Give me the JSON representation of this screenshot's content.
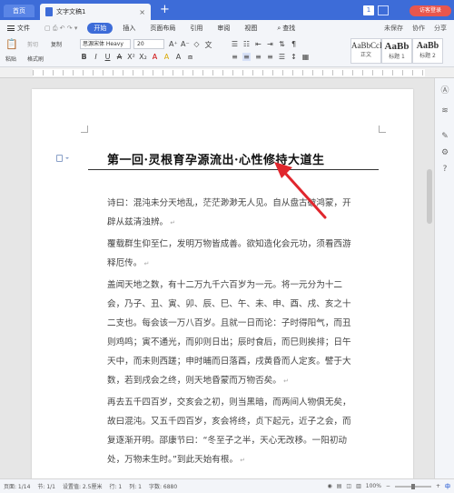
{
  "titlebar": {
    "home_tab": "首页",
    "doc_tab": "文字文稿1",
    "close_glyph": "×",
    "add_glyph": "+",
    "badge": "1",
    "visitor": "访客登录"
  },
  "menu": {
    "file": "文件",
    "items": [
      "开始",
      "插入",
      "页面布局",
      "引用",
      "审阅",
      "视图"
    ],
    "active": "开始",
    "search": "查找",
    "right": [
      "未保存",
      "协作",
      "分享"
    ]
  },
  "ribbon": {
    "paste": "粘贴",
    "cut": "剪切",
    "copy": "复制",
    "format_painter": "格式刷",
    "font_name": "思源宋体 Heavy",
    "font_size": "20",
    "styles": [
      {
        "preview": "AaBbCcDd",
        "name": "正文"
      },
      {
        "preview": "AaBb",
        "name": "标题 1"
      },
      {
        "preview": "AaBb",
        "name": "标题 2"
      }
    ]
  },
  "document": {
    "title": "第一回·灵根育孕源流出·心性修持大道生",
    "paragraphs": [
      "诗曰：混沌未分天地乱，茫茫渺渺无人见。自从盘古破鸿蒙，开辟从兹清浊辨。",
      "覆载群生仰至仁，发明万物皆成善。欲知造化会元功，须看西游释厄传。",
      "盖闻天地之数，有十二万九千六百岁为一元。将一元分为十二会，乃子、丑、寅、卯、辰、巳、午、未、申、酉、戌、亥之十二支也。每会该一万八百岁。且就一日而论：子时得阳气，而丑则鸡鸣；寅不通光，而卯则日出；辰时食后，而巳则挨排；日午天中，而未则西蹉；申时晡而日落酉，戌黄昏而人定亥。譬于大数，若到戌会之终，则天地昏蒙而万物否矣。",
      "再去五千四百岁，交亥会之初，则当黑暗，而两间人物俱无矣，故曰混沌。又五千四百岁，亥会将终，贞下起元，近子之会，而复逐渐开明。邵康节曰：“冬至子之半，天心无改移。一阳初动处，万物未生时。”到此天始有根。"
    ]
  },
  "statusbar": {
    "page": "页面: 1/14",
    "sections": "节: 1/1",
    "setting": "设置值: 2.5厘米",
    "row": "行: 1",
    "column": "列: 1",
    "word_count": "字数: 6880",
    "zoom": "100%",
    "ime_label": "中"
  },
  "colors": {
    "accent": "#3d6cd8",
    "arrow": "#e0262d",
    "visitor": "#e8564e"
  }
}
